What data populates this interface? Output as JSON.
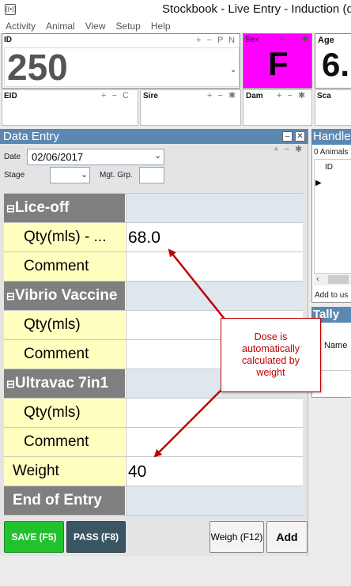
{
  "window": {
    "title": "Stockbook - Live Entry - Induction (d"
  },
  "menu": [
    "Activity",
    "Animal",
    "View",
    "Setup",
    "Help"
  ],
  "id_panel": {
    "label": "ID",
    "value": "250",
    "controls": "+ −  P  N"
  },
  "sex_panel": {
    "label": "Sex",
    "value": "F"
  },
  "age_panel": {
    "label": "Age",
    "value": "6."
  },
  "eid_panel": {
    "label": "EID",
    "controls": "+ −  C"
  },
  "sire_panel": {
    "label": "Sire"
  },
  "dam_panel": {
    "label": "Dam"
  },
  "sca_panel": {
    "label": "Sca"
  },
  "data_entry": {
    "title": "Data Entry",
    "date_label": "Date",
    "date_value": "02/06/2017",
    "stage_label": "Stage",
    "mgt_label": "Mgt. Grp.",
    "rows": [
      {
        "type": "section",
        "label": "Lice-off",
        "value": ""
      },
      {
        "type": "field",
        "label": "Qty(mls) - ...",
        "value": "68.0"
      },
      {
        "type": "field",
        "label": "Comment",
        "value": ""
      },
      {
        "type": "section",
        "label": "Vibrio Vaccine",
        "value": ""
      },
      {
        "type": "field",
        "label": "Qty(mls)",
        "value": ""
      },
      {
        "type": "field",
        "label": "Comment",
        "value": ""
      },
      {
        "type": "section",
        "label": "Ultravac 7in1",
        "value": ""
      },
      {
        "type": "field",
        "label": "Qty(mls)",
        "value": ""
      },
      {
        "type": "field",
        "label": "Comment",
        "value": ""
      },
      {
        "type": "plain",
        "label": "Weight",
        "value": "40"
      },
      {
        "type": "section",
        "label": "End of Entry",
        "value": ""
      }
    ]
  },
  "buttons": {
    "save": "SAVE (F5)",
    "pass": "PASS (F8)",
    "weigh": "Weigh (F12)",
    "add": "Add"
  },
  "handler_panel": {
    "title": "Handle",
    "animals": "0 Animals",
    "col_id": "ID",
    "add_to": "Add to us"
  },
  "tally_panel": {
    "title": "Tally",
    "col_name": "Name"
  },
  "callout": {
    "text": "Dose is automatically calculated by weight"
  },
  "colors": {
    "header_blue": "#5b88b2",
    "sex_magenta": "#ff00ff",
    "save_green": "#22c22e",
    "pass_dark": "#3b5663",
    "section_grey": "#7f7f7f",
    "field_yellow": "#ffffc0",
    "callout_red": "#c00000"
  }
}
